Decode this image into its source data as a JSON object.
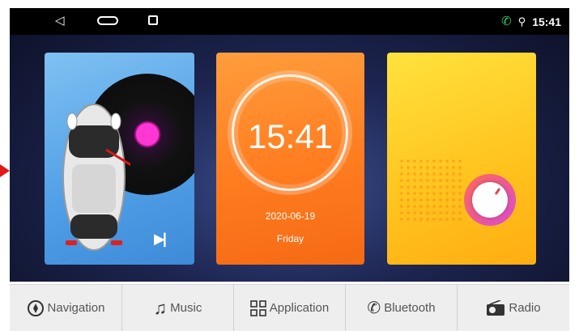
{
  "status_bar": {
    "back_icon": "back-triangle-icon",
    "home_icon": "home-pill-icon",
    "recent_icon": "recent-apps-icon",
    "time": "15:41",
    "phone_color": "#2ecc71"
  },
  "cards": {
    "music": {
      "next_icon": "skip-next-icon"
    },
    "clock": {
      "time": "15:41",
      "date": "2020-06-19",
      "day": "Friday"
    },
    "radio": {
      "knob_icon": "radio-knob-icon"
    }
  },
  "dock": {
    "items": [
      {
        "label": "Navigation",
        "icon": "compass-icon"
      },
      {
        "label": "Music",
        "icon": "music-note-icon"
      },
      {
        "label": "Application",
        "icon": "app-grid-icon"
      },
      {
        "label": "Bluetooth",
        "icon": "bluetooth-phone-icon"
      },
      {
        "label": "Radio",
        "icon": "radio-icon"
      }
    ]
  },
  "colors": {
    "music_card": "#4f9ee6",
    "clock_card": "#ff7c1f",
    "radio_card": "#ffc21d"
  }
}
